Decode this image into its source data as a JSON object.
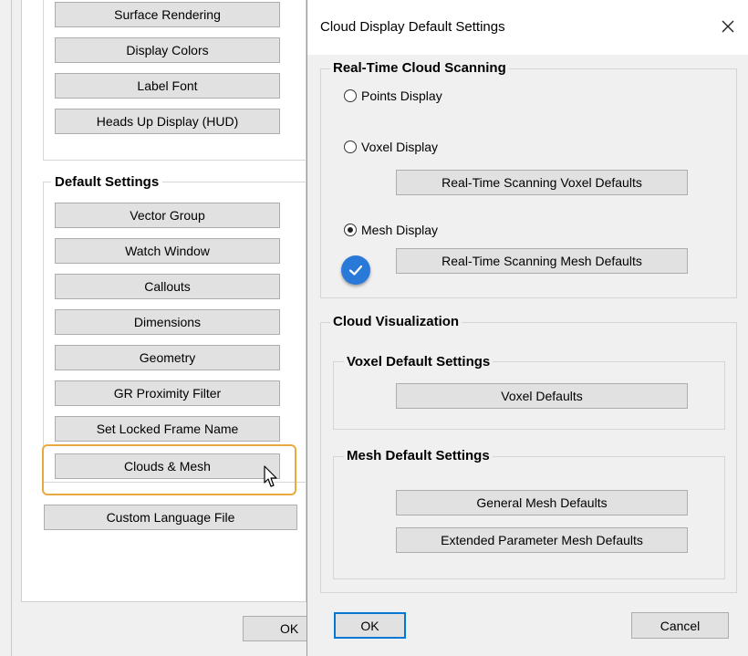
{
  "background_window": {
    "buttons_top": [
      "Surface Rendering",
      "Display Colors",
      "Label Font",
      "Heads Up Display (HUD)"
    ],
    "default_settings": {
      "title": "Default Settings",
      "buttons": [
        "Vector Group",
        "Watch Window",
        "Callouts",
        "Dimensions",
        "Geometry",
        "GR Proximity Filter",
        "Set Locked Frame Name",
        "Clouds & Mesh"
      ]
    },
    "custom_language_label": "Custom Language File",
    "ok_label": "OK",
    "highlight_color": "#e9a93e"
  },
  "dialog": {
    "title": "Cloud Display Default Settings",
    "close_icon": "close-icon",
    "realtime": {
      "title": "Real-Time Cloud Scanning",
      "points_label": "Points Display",
      "voxel_label": "Voxel Display",
      "voxel_defaults_label": "Real-Time Scanning Voxel Defaults",
      "mesh_label": "Mesh Display",
      "mesh_defaults_label": "Real-Time Scanning Mesh Defaults",
      "selected": "Mesh Display"
    },
    "visualization": {
      "title": "Cloud Visualization",
      "voxel_group_title": "Voxel Default Settings",
      "voxel_defaults_label": "Voxel Defaults",
      "mesh_group_title": "Mesh Default Settings",
      "general_mesh_label": "General Mesh Defaults",
      "extended_mesh_label": "Extended Parameter Mesh Defaults"
    },
    "ok_label": "OK",
    "cancel_label": "Cancel",
    "accent_color": "#0078d7",
    "badge_color": "#2979d9"
  }
}
